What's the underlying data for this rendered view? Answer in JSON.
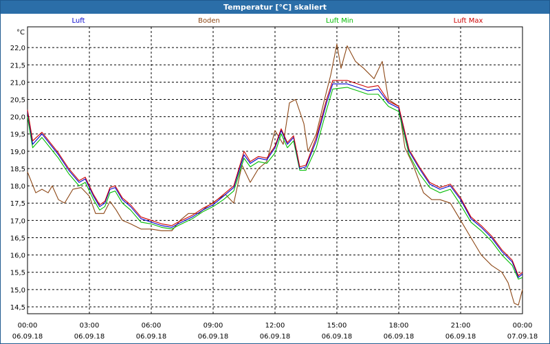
{
  "window": {
    "title": "Temperatur [°C] skaliert"
  },
  "chart_data": {
    "type": "line",
    "title": "Temperatur [°C] skaliert",
    "ylabel": "°C",
    "ylim": [
      14.3,
      22.6
    ],
    "y_ticks": [
      "22,0",
      "21,5",
      "21,0",
      "20,5",
      "20,0",
      "19,5",
      "19,0",
      "18,5",
      "18,0",
      "17,5",
      "17,0",
      "16,5",
      "16,0",
      "15,5",
      "15,0",
      "14,5"
    ],
    "y_tick_values": [
      22.0,
      21.5,
      21.0,
      20.5,
      20.0,
      19.5,
      19.0,
      18.5,
      18.0,
      17.5,
      17.0,
      16.5,
      16.0,
      15.5,
      15.0,
      14.5
    ],
    "x_tick_hours": [
      0,
      3,
      6,
      9,
      12,
      15,
      18,
      21,
      24
    ],
    "x_ticks": [
      {
        "time": "00:00",
        "date": "06.09.18"
      },
      {
        "time": "03:00",
        "date": "06.09.18"
      },
      {
        "time": "06:00",
        "date": "06.09.18"
      },
      {
        "time": "09:00",
        "date": "06.09.18"
      },
      {
        "time": "12:00",
        "date": "06.09.18"
      },
      {
        "time": "15:00",
        "date": "06.09.18"
      },
      {
        "time": "18:00",
        "date": "06.09.18"
      },
      {
        "time": "21:00",
        "date": "06.09.18"
      },
      {
        "time": "00:00",
        "date": "07.09.18"
      }
    ],
    "grid": true,
    "legend_position": "top",
    "series": [
      {
        "name": "Luft",
        "color": "#0000cc",
        "points": [
          [
            0,
            20.15
          ],
          [
            0.25,
            19.2
          ],
          [
            0.7,
            19.5
          ],
          [
            1.5,
            18.9
          ],
          [
            2.0,
            18.45
          ],
          [
            2.5,
            18.1
          ],
          [
            2.8,
            18.2
          ],
          [
            3.2,
            17.7
          ],
          [
            3.5,
            17.4
          ],
          [
            3.75,
            17.5
          ],
          [
            4.0,
            17.9
          ],
          [
            4.25,
            17.95
          ],
          [
            4.6,
            17.6
          ],
          [
            5.0,
            17.4
          ],
          [
            5.5,
            17.05
          ],
          [
            6.0,
            16.95
          ],
          [
            6.5,
            16.85
          ],
          [
            7.0,
            16.8
          ],
          [
            7.3,
            16.9
          ],
          [
            8.0,
            17.1
          ],
          [
            8.5,
            17.3
          ],
          [
            9.0,
            17.45
          ],
          [
            9.5,
            17.7
          ],
          [
            10.0,
            17.95
          ],
          [
            10.5,
            18.9
          ],
          [
            10.8,
            18.65
          ],
          [
            11.2,
            18.8
          ],
          [
            11.6,
            18.75
          ],
          [
            12.0,
            19.1
          ],
          [
            12.3,
            19.6
          ],
          [
            12.6,
            19.2
          ],
          [
            12.9,
            19.4
          ],
          [
            13.2,
            18.5
          ],
          [
            13.5,
            18.55
          ],
          [
            14.0,
            19.3
          ],
          [
            14.5,
            20.4
          ],
          [
            14.8,
            20.95
          ],
          [
            15.5,
            20.95
          ],
          [
            16.0,
            20.85
          ],
          [
            16.5,
            20.75
          ],
          [
            17.0,
            20.8
          ],
          [
            17.5,
            20.4
          ],
          [
            18.0,
            20.25
          ],
          [
            18.5,
            19.0
          ],
          [
            19.0,
            18.5
          ],
          [
            19.5,
            18.05
          ],
          [
            20.0,
            17.9
          ],
          [
            20.5,
            18.0
          ],
          [
            21.0,
            17.6
          ],
          [
            21.5,
            17.05
          ],
          [
            22.0,
            16.8
          ],
          [
            22.5,
            16.5
          ],
          [
            23.0,
            16.1
          ],
          [
            23.5,
            15.8
          ],
          [
            23.8,
            15.35
          ],
          [
            24.0,
            15.45
          ]
        ]
      },
      {
        "name": "Boden",
        "color": "#8b4513",
        "points": [
          [
            0,
            18.4
          ],
          [
            0.4,
            17.8
          ],
          [
            0.7,
            17.9
          ],
          [
            1.0,
            17.8
          ],
          [
            1.2,
            18.0
          ],
          [
            1.5,
            17.6
          ],
          [
            1.8,
            17.5
          ],
          [
            2.2,
            17.9
          ],
          [
            2.6,
            17.95
          ],
          [
            3.0,
            17.7
          ],
          [
            3.3,
            17.2
          ],
          [
            3.7,
            17.2
          ],
          [
            4.0,
            17.55
          ],
          [
            4.3,
            17.3
          ],
          [
            4.6,
            17.0
          ],
          [
            5.0,
            16.9
          ],
          [
            5.5,
            16.75
          ],
          [
            6.0,
            16.75
          ],
          [
            6.5,
            16.7
          ],
          [
            7.0,
            16.7
          ],
          [
            7.4,
            17.0
          ],
          [
            7.8,
            17.2
          ],
          [
            8.3,
            17.2
          ],
          [
            8.7,
            17.4
          ],
          [
            9.2,
            17.6
          ],
          [
            9.6,
            17.75
          ],
          [
            10.0,
            17.5
          ],
          [
            10.4,
            18.6
          ],
          [
            10.8,
            18.1
          ],
          [
            11.2,
            18.5
          ],
          [
            11.6,
            18.7
          ],
          [
            12.0,
            19.6
          ],
          [
            12.4,
            19.2
          ],
          [
            12.7,
            20.4
          ],
          [
            13.0,
            20.5
          ],
          [
            13.4,
            19.8
          ],
          [
            13.6,
            19.0
          ],
          [
            14.0,
            19.5
          ],
          [
            14.4,
            20.5
          ],
          [
            14.7,
            21.2
          ],
          [
            15.0,
            22.1
          ],
          [
            15.2,
            21.4
          ],
          [
            15.5,
            22.05
          ],
          [
            15.9,
            21.6
          ],
          [
            16.3,
            21.4
          ],
          [
            16.8,
            21.1
          ],
          [
            17.2,
            21.6
          ],
          [
            17.5,
            20.5
          ],
          [
            18.0,
            20.3
          ],
          [
            18.3,
            19.1
          ],
          [
            18.7,
            18.6
          ],
          [
            19.2,
            17.8
          ],
          [
            19.6,
            17.6
          ],
          [
            20.0,
            17.6
          ],
          [
            20.5,
            17.5
          ],
          [
            21.0,
            17.0
          ],
          [
            21.5,
            16.5
          ],
          [
            22.0,
            16.0
          ],
          [
            22.5,
            15.7
          ],
          [
            23.0,
            15.5
          ],
          [
            23.3,
            15.2
          ],
          [
            23.6,
            14.6
          ],
          [
            23.8,
            14.55
          ],
          [
            24.0,
            15.0
          ]
        ]
      },
      {
        "name": "Luft Min",
        "color": "#00bb00",
        "points": [
          [
            0,
            20.0
          ],
          [
            0.25,
            19.1
          ],
          [
            0.7,
            19.4
          ],
          [
            1.5,
            18.8
          ],
          [
            2.0,
            18.35
          ],
          [
            2.5,
            18.0
          ],
          [
            2.8,
            18.1
          ],
          [
            3.2,
            17.6
          ],
          [
            3.5,
            17.3
          ],
          [
            3.75,
            17.4
          ],
          [
            4.0,
            17.8
          ],
          [
            4.25,
            17.85
          ],
          [
            4.6,
            17.5
          ],
          [
            5.0,
            17.3
          ],
          [
            5.5,
            16.95
          ],
          [
            6.0,
            16.9
          ],
          [
            6.5,
            16.8
          ],
          [
            7.0,
            16.75
          ],
          [
            7.3,
            16.85
          ],
          [
            8.0,
            17.05
          ],
          [
            8.5,
            17.25
          ],
          [
            9.0,
            17.4
          ],
          [
            9.5,
            17.6
          ],
          [
            10.0,
            17.85
          ],
          [
            10.5,
            18.8
          ],
          [
            10.8,
            18.55
          ],
          [
            11.2,
            18.7
          ],
          [
            11.6,
            18.65
          ],
          [
            12.0,
            18.95
          ],
          [
            12.3,
            19.5
          ],
          [
            12.6,
            19.1
          ],
          [
            12.9,
            19.3
          ],
          [
            13.2,
            18.45
          ],
          [
            13.5,
            18.45
          ],
          [
            14.0,
            19.1
          ],
          [
            14.5,
            20.2
          ],
          [
            14.8,
            20.8
          ],
          [
            15.5,
            20.85
          ],
          [
            16.0,
            20.75
          ],
          [
            16.5,
            20.65
          ],
          [
            17.0,
            20.65
          ],
          [
            17.5,
            20.3
          ],
          [
            18.0,
            20.15
          ],
          [
            18.5,
            18.9
          ],
          [
            19.0,
            18.35
          ],
          [
            19.5,
            17.95
          ],
          [
            20.0,
            17.8
          ],
          [
            20.5,
            17.9
          ],
          [
            21.0,
            17.45
          ],
          [
            21.5,
            16.95
          ],
          [
            22.0,
            16.7
          ],
          [
            22.5,
            16.4
          ],
          [
            23.0,
            16.0
          ],
          [
            23.5,
            15.7
          ],
          [
            23.8,
            15.3
          ],
          [
            24.0,
            15.35
          ]
        ]
      },
      {
        "name": "Luft Max",
        "color": "#cc0000",
        "points": [
          [
            0,
            20.2
          ],
          [
            0.25,
            19.3
          ],
          [
            0.7,
            19.55
          ],
          [
            1.5,
            18.95
          ],
          [
            2.0,
            18.5
          ],
          [
            2.5,
            18.15
          ],
          [
            2.8,
            18.25
          ],
          [
            3.2,
            17.75
          ],
          [
            3.5,
            17.45
          ],
          [
            3.75,
            17.55
          ],
          [
            4.0,
            17.95
          ],
          [
            4.25,
            18.0
          ],
          [
            4.6,
            17.65
          ],
          [
            5.0,
            17.45
          ],
          [
            5.5,
            17.1
          ],
          [
            6.0,
            17.0
          ],
          [
            6.5,
            16.9
          ],
          [
            7.0,
            16.85
          ],
          [
            7.3,
            16.95
          ],
          [
            8.0,
            17.15
          ],
          [
            8.5,
            17.35
          ],
          [
            9.0,
            17.5
          ],
          [
            9.5,
            17.75
          ],
          [
            10.0,
            18.0
          ],
          [
            10.5,
            19.0
          ],
          [
            10.8,
            18.7
          ],
          [
            11.2,
            18.85
          ],
          [
            11.6,
            18.8
          ],
          [
            12.0,
            19.15
          ],
          [
            12.3,
            19.65
          ],
          [
            12.6,
            19.25
          ],
          [
            12.9,
            19.45
          ],
          [
            13.2,
            18.55
          ],
          [
            13.5,
            18.6
          ],
          [
            14.0,
            19.4
          ],
          [
            14.5,
            20.5
          ],
          [
            14.8,
            21.05
          ],
          [
            15.5,
            21.05
          ],
          [
            16.0,
            20.95
          ],
          [
            16.5,
            20.85
          ],
          [
            17.0,
            20.9
          ],
          [
            17.5,
            20.45
          ],
          [
            18.0,
            20.3
          ],
          [
            18.5,
            19.05
          ],
          [
            19.0,
            18.55
          ],
          [
            19.5,
            18.1
          ],
          [
            20.0,
            17.95
          ],
          [
            20.5,
            18.05
          ],
          [
            21.0,
            17.65
          ],
          [
            21.5,
            17.1
          ],
          [
            22.0,
            16.85
          ],
          [
            22.5,
            16.55
          ],
          [
            23.0,
            16.15
          ],
          [
            23.5,
            15.85
          ],
          [
            23.8,
            15.4
          ],
          [
            24.0,
            15.5
          ]
        ]
      }
    ]
  }
}
